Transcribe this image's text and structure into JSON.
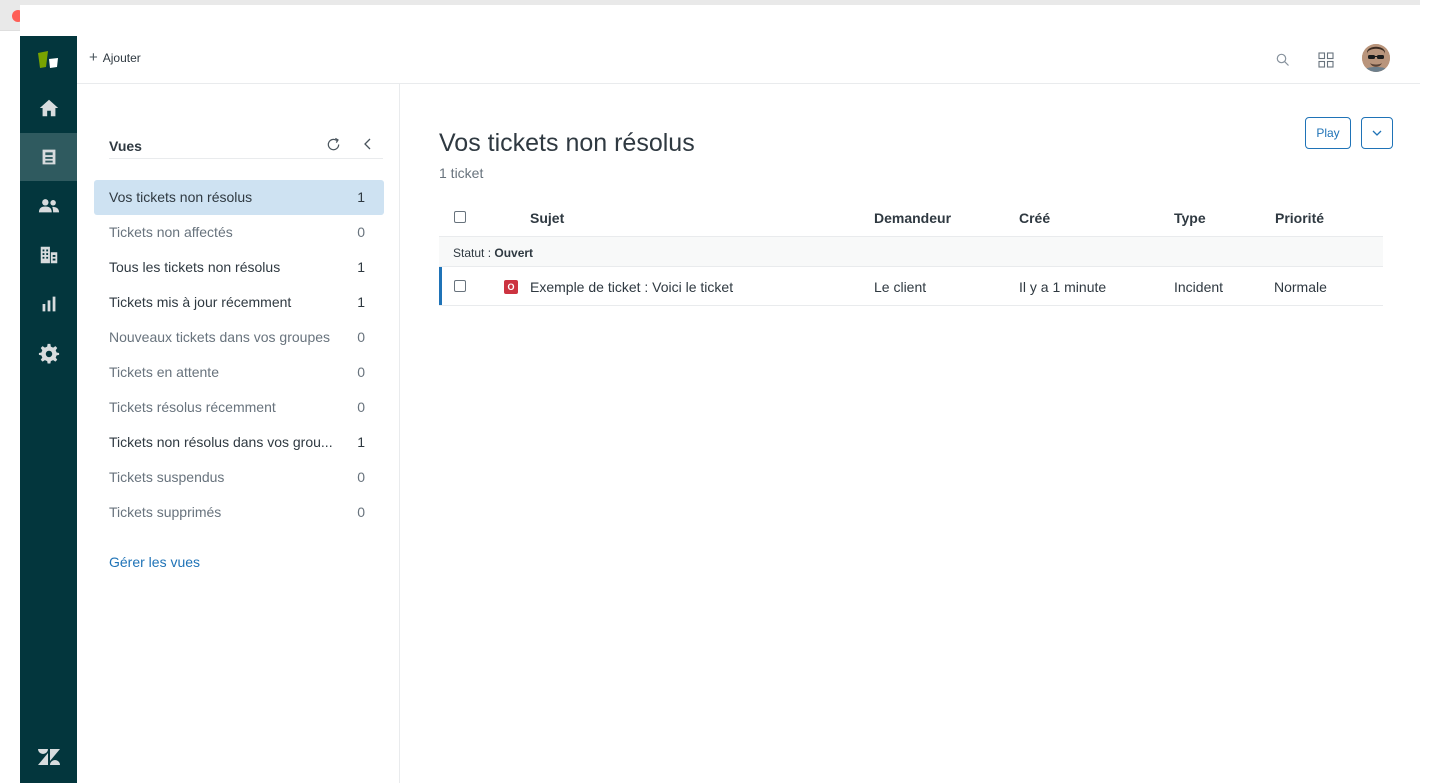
{
  "topbar": {
    "add_label": "Ajouter"
  },
  "nav": {
    "items": [
      "home-icon",
      "views-icon",
      "customers-icon",
      "organizations-icon",
      "reporting-icon",
      "settings-icon"
    ],
    "active": "views-icon"
  },
  "views": {
    "title": "Vues",
    "items": [
      {
        "label": "Vos tickets non résolus",
        "count": "1",
        "selected": true,
        "muted": false
      },
      {
        "label": "Tickets non affectés",
        "count": "0",
        "selected": false,
        "muted": true
      },
      {
        "label": "Tous les tickets non résolus",
        "count": "1",
        "selected": false,
        "muted": false
      },
      {
        "label": "Tickets mis à jour récemment",
        "count": "1",
        "selected": false,
        "muted": false
      },
      {
        "label": "Nouveaux tickets dans vos groupes",
        "count": "0",
        "selected": false,
        "muted": true
      },
      {
        "label": "Tickets en attente",
        "count": "0",
        "selected": false,
        "muted": true
      },
      {
        "label": "Tickets résolus récemment",
        "count": "0",
        "selected": false,
        "muted": true
      },
      {
        "label": "Tickets non résolus dans vos grou...",
        "count": "1",
        "selected": false,
        "muted": false
      },
      {
        "label": "Tickets suspendus",
        "count": "0",
        "selected": false,
        "muted": true
      },
      {
        "label": "Tickets supprimés",
        "count": "0",
        "selected": false,
        "muted": true
      }
    ],
    "manage_label": "Gérer les vues"
  },
  "main": {
    "title": "Vos tickets non résolus",
    "count_label": "1 ticket",
    "play_label": "Play",
    "columns": {
      "subject": "Sujet",
      "requester": "Demandeur",
      "created": "Créé",
      "type": "Type",
      "priority": "Priorité"
    },
    "group": {
      "prefix": "Statut : ",
      "value": "Ouvert"
    },
    "rows": [
      {
        "status_letter": "O",
        "subject": "Exemple de ticket : Voici le ticket",
        "requester": "Le client",
        "created": "Il y a 1 minute",
        "type": "Incident",
        "priority": "Normale"
      }
    ]
  },
  "colors": {
    "nav_bg": "#03363d",
    "nav_active": "#2f5a5f",
    "accent": "#1f73b7",
    "selected_view": "#cee2f2",
    "status_open": "#cc3340",
    "logo_green": "#78a300"
  }
}
